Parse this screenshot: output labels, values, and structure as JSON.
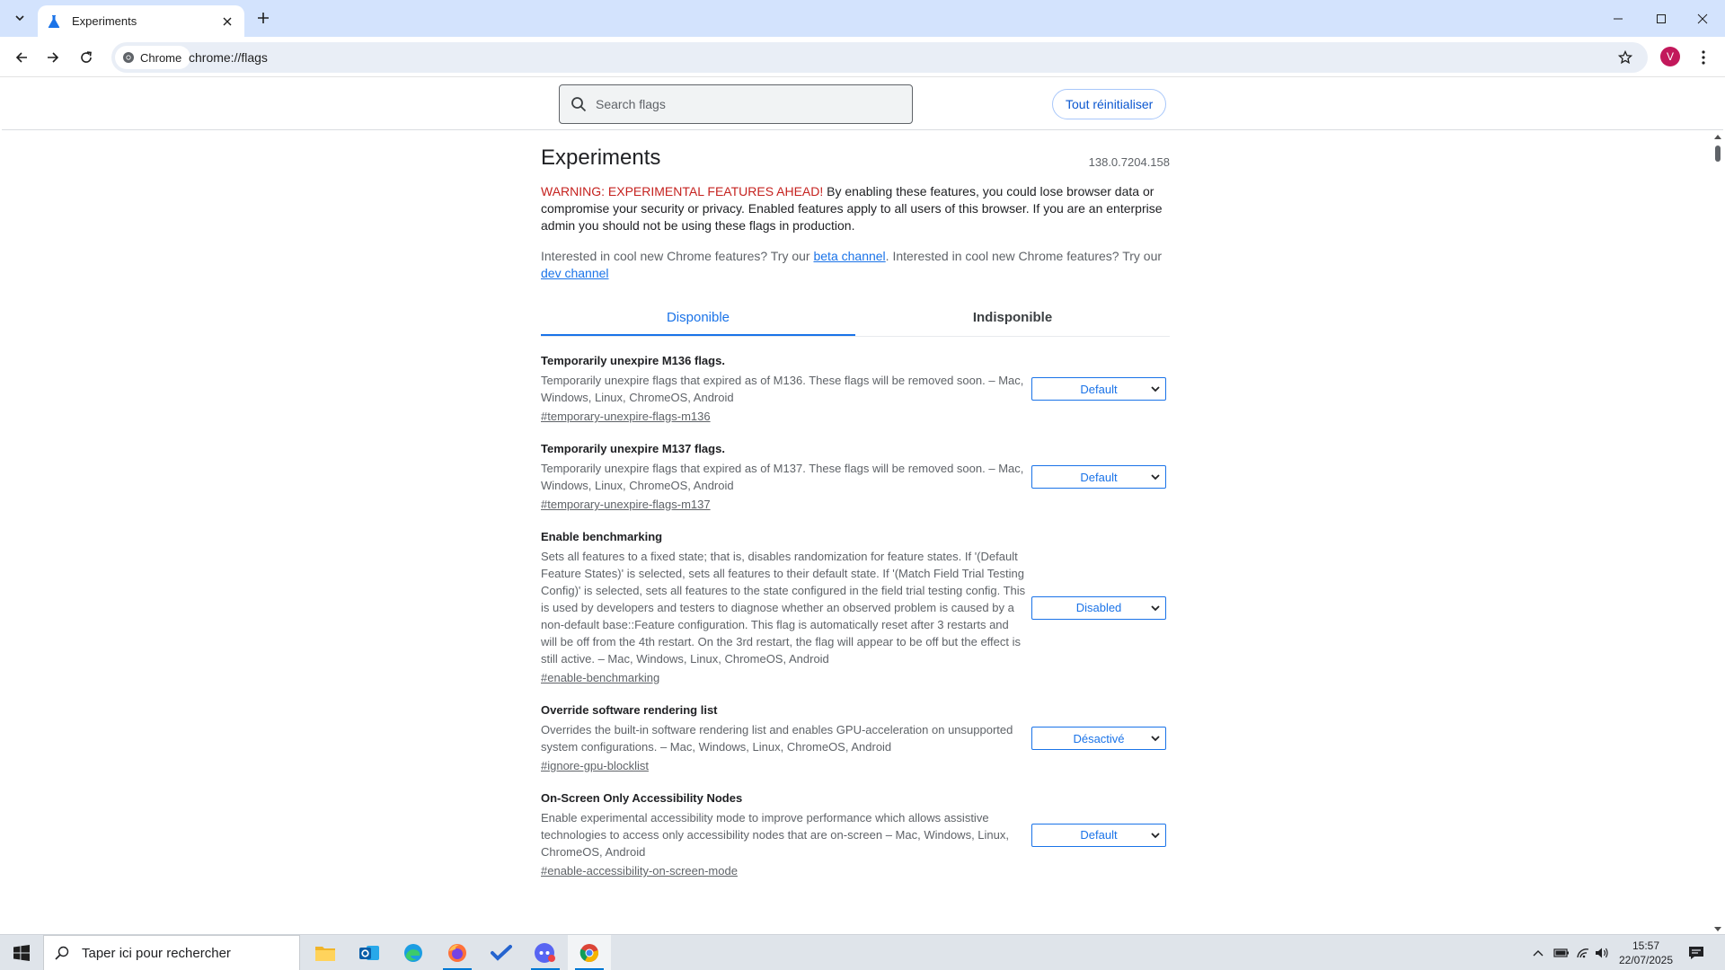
{
  "browser": {
    "tab_title": "Experiments",
    "chip_label": "Chrome",
    "url": "chrome://flags",
    "avatar_letter": "V"
  },
  "header": {
    "search_placeholder": "Search flags",
    "reset_label": "Tout réinitialiser"
  },
  "page": {
    "title": "Experiments",
    "version": "138.0.7204.158",
    "warning_prefix": "WARNING: EXPERIMENTAL FEATURES AHEAD!",
    "warning_body": " By enabling these features, you could lose browser data or compromise your security or privacy. Enabled features apply to all users of this browser. If you are an enterprise admin you should not be using these flags in production.",
    "interest_1": "Interested in cool new Chrome features? Try our ",
    "beta_link": "beta channel",
    "interest_2": ". Interested in cool new Chrome features? Try our ",
    "dev_link": "dev channel",
    "tabs": [
      {
        "label": "Disponible",
        "active": true
      },
      {
        "label": "Indisponible",
        "active": false
      }
    ]
  },
  "experiments": [
    {
      "name": "Temporarily unexpire M136 flags.",
      "desc": "Temporarily unexpire flags that expired as of M136. These flags will be removed soon. – Mac, Windows, Linux, ChromeOS, Android",
      "permalink": "#temporary-unexpire-flags-m136",
      "value": "Default"
    },
    {
      "name": "Temporarily unexpire M137 flags.",
      "desc": "Temporarily unexpire flags that expired as of M137. These flags will be removed soon. – Mac, Windows, Linux, ChromeOS, Android",
      "permalink": "#temporary-unexpire-flags-m137",
      "value": "Default"
    },
    {
      "name": "Enable benchmarking",
      "desc": "Sets all features to a fixed state; that is, disables randomization for feature states. If '(Default Feature States)' is selected, sets all features to their default state. If '(Match Field Trial Testing Config)' is selected, sets all features to the state configured in the field trial testing config. This is used by developers and testers to diagnose whether an observed problem is caused by a non-default base::Feature configuration. This flag is automatically reset after 3 restarts and will be off from the 4th restart. On the 3rd restart, the flag will appear to be off but the effect is still active. – Mac, Windows, Linux, ChromeOS, Android",
      "permalink": "#enable-benchmarking",
      "value": "Disabled"
    },
    {
      "name": "Override software rendering list",
      "desc": "Overrides the built-in software rendering list and enables GPU-acceleration on unsupported system configurations. – Mac, Windows, Linux, ChromeOS, Android",
      "permalink": "#ignore-gpu-blocklist",
      "value": "Désactivé"
    },
    {
      "name": "On-Screen Only Accessibility Nodes",
      "desc": "Enable experimental accessibility mode to improve performance which allows assistive technologies to access only accessibility nodes that are on-screen – Mac, Windows, Linux, ChromeOS, Android",
      "permalink": "#enable-accessibility-on-screen-mode",
      "value": "Default"
    }
  ],
  "taskbar": {
    "search_text": "Taper ici pour rechercher",
    "time": "15:57",
    "date": "22/07/2025",
    "apps": [
      "file-explorer-icon",
      "outlook-icon",
      "edge-icon",
      "firefox-icon",
      "todo-icon",
      "discord-icon",
      "chrome-icon"
    ]
  },
  "colors": {
    "accent": "#1a73e8",
    "warning": "#c5221f",
    "tabstrip": "#d3e3fd"
  }
}
